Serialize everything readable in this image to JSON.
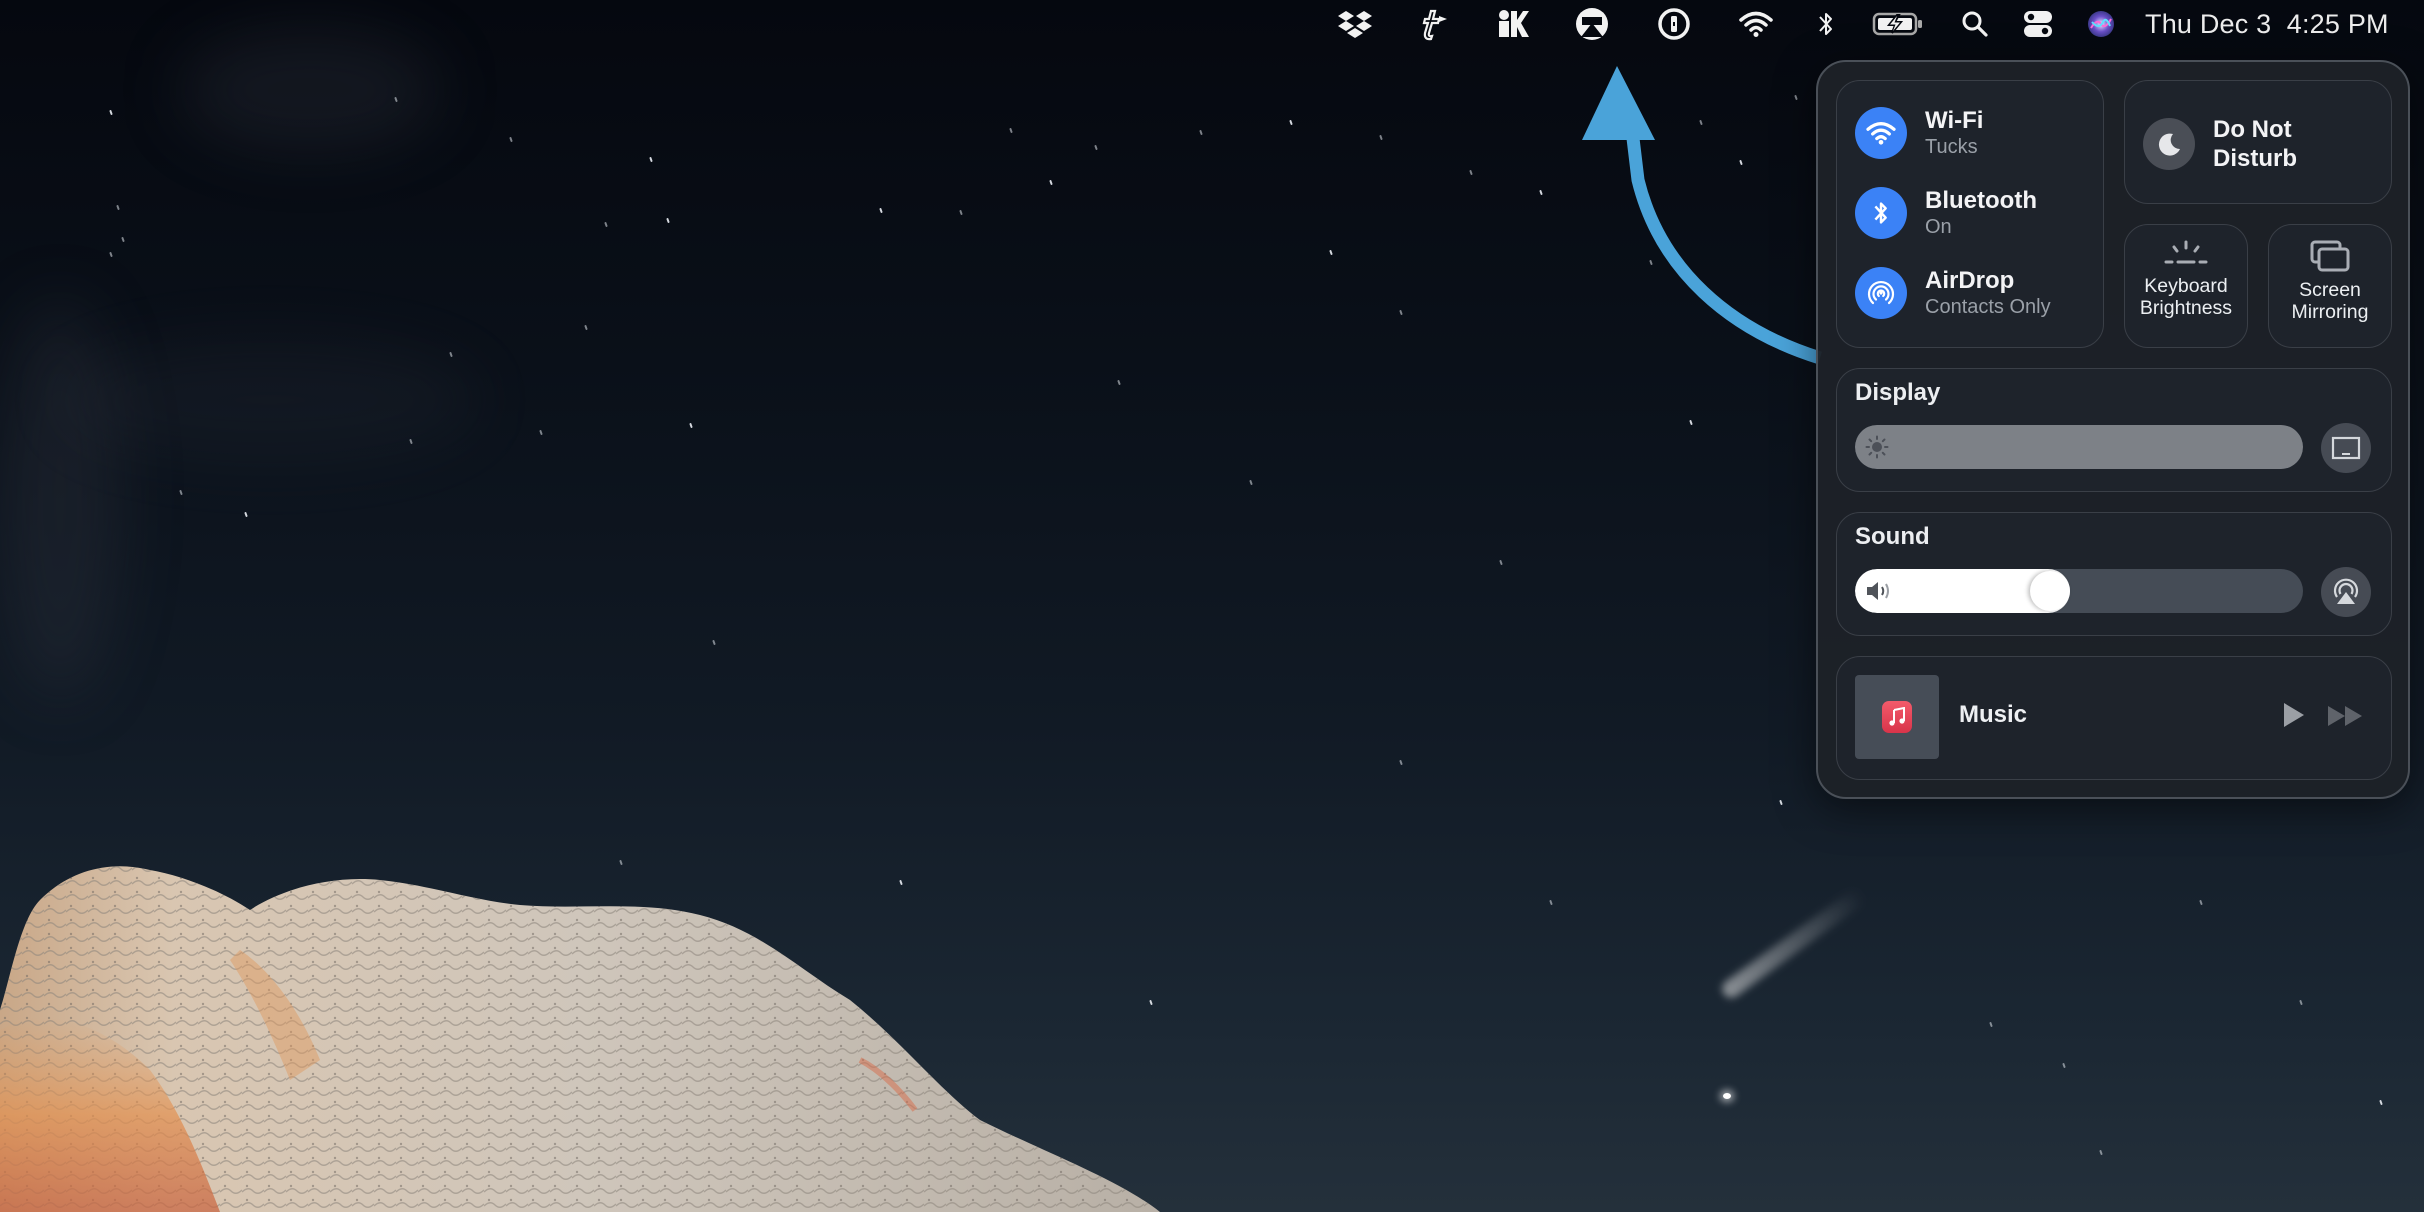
{
  "desktop": {
    "wallpaper": "night sky with comet over white rock formation"
  },
  "menubar": {
    "icons": [
      {
        "name": "dropbox-icon"
      },
      {
        "name": "typeeto-icon"
      },
      {
        "name": "klokki-icon"
      },
      {
        "name": "airserver-icon"
      },
      {
        "name": "1password-icon"
      },
      {
        "name": "wifi-icon"
      },
      {
        "name": "bluetooth-icon"
      },
      {
        "name": "battery-charging-icon"
      },
      {
        "name": "spotlight-search-icon"
      },
      {
        "name": "control-center-icon"
      },
      {
        "name": "siri-icon"
      }
    ],
    "date": "Thu Dec 3",
    "time": "4:25 PM"
  },
  "annotation": {
    "arrow_color": "#4aa3d9",
    "points_to": "control-center-icon"
  },
  "control_center": {
    "connectivity": [
      {
        "title": "Wi-Fi",
        "subtitle": "Tucks",
        "icon": "wifi-icon",
        "active": true
      },
      {
        "title": "Bluetooth",
        "subtitle": "On",
        "icon": "bluetooth-icon",
        "active": true
      },
      {
        "title": "AirDrop",
        "subtitle": "Contacts Only",
        "icon": "airdrop-icon",
        "active": true
      }
    ],
    "do_not_disturb": {
      "title": "Do Not Disturb",
      "line1": "Do Not",
      "line2": "Disturb",
      "active": false
    },
    "keyboard_brightness": {
      "line1": "Keyboard",
      "line2": "Brightness"
    },
    "screen_mirroring": {
      "line1": "Screen",
      "line2": "Mirroring"
    },
    "display": {
      "title": "Display",
      "brightness_percent": 100
    },
    "sound": {
      "title": "Sound",
      "volume_percent": 43
    },
    "now_playing": {
      "app": "Music",
      "state": "paused"
    },
    "accent_color": "#3b82f6"
  }
}
